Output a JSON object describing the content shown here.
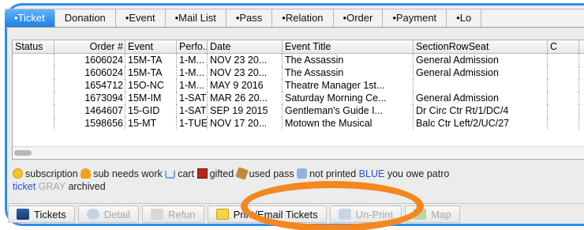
{
  "tabs": [
    "•Ticket",
    "Donation",
    "•Event",
    "•Mail List",
    "•Pass",
    "•Relation",
    "•Order",
    "•Payment",
    "•Lo"
  ],
  "table": {
    "headers": [
      "Status",
      "Order #",
      "Event",
      "Perfo...",
      "Date",
      "Event Title",
      "SectionRowSeat",
      "C"
    ],
    "rows": [
      [
        "",
        "1606024",
        "15M-TA",
        "1-M...",
        "NOV 23 20...",
        "The Assassin",
        "General Admission",
        ""
      ],
      [
        "",
        "1606024",
        "15M-TA",
        "1-M...",
        "NOV 23 20...",
        "The Assassin",
        "General Admission",
        ""
      ],
      [
        "",
        "1654712",
        "15O-NC",
        "1-M...",
        "MAY 9 2016",
        "Theatre Manager 1st...",
        "",
        ""
      ],
      [
        "",
        "1673094",
        "15M-IM",
        "1-SAT",
        "MAR 26 20...",
        "Saturday Morning Ce...",
        "General Admission",
        ""
      ],
      [
        "",
        "1464607",
        "15-GID",
        "1-SAT",
        "SEP 19 2015",
        "Gentleman's Guide I...",
        "Dr Circ Ctr Rt/1/DC/4",
        ""
      ],
      [
        "",
        "1598656",
        "15-MT",
        "1-TUE",
        "NOV 17 20...",
        "Motown the Musical",
        "Balc Ctr Left/2/UC/27",
        ""
      ]
    ]
  },
  "legend": {
    "subscription": "subscription",
    "sub_needs_work": "sub needs work",
    "cart": "cart",
    "gifted": "gifted",
    "used_pass": "used pass",
    "not_printed": "not printed",
    "blue_word": "BLUE",
    "owe": "you owe patro",
    "ticket": "ticket",
    "gray_word": "GRAY",
    "archived": "archived"
  },
  "toolbar": {
    "tickets": "Tickets",
    "detail": "Detail",
    "refund": "Refun",
    "print_email": "Print/Email Tickets",
    "unprint": "Un-Print",
    "map": "Map"
  },
  "colors": {
    "frame": "#2f8ff0",
    "active_tab": "#1d7fe0",
    "highlight": "#f4871f",
    "blue_text": "#2255d6",
    "gray_text": "#a9a9a9"
  }
}
